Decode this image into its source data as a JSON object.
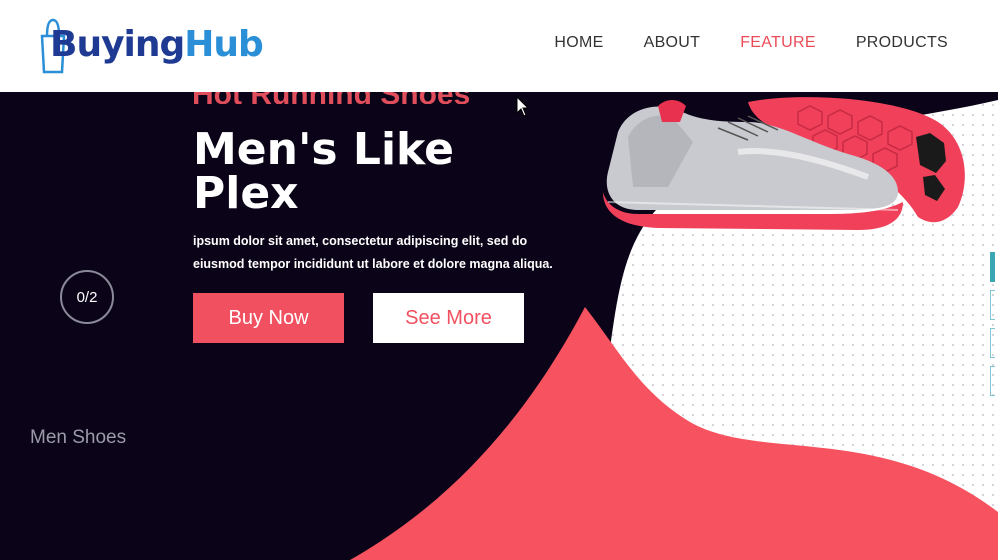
{
  "header": {
    "logo": {
      "brand": "Buying",
      "brand_accent": "Hub"
    },
    "nav": [
      {
        "label": "HOME"
      },
      {
        "label": "ABOUT"
      },
      {
        "label": "FEATURE",
        "active": true
      },
      {
        "label": "PRODUCTS"
      }
    ]
  },
  "hero": {
    "slide_counter": "0/2",
    "category": "Men Shoes",
    "kicker": "Hot Running Shoes",
    "title": "Men's Like Plex",
    "description": "ipsum dolor sit amet, consectetur adipiscing elit, sed do eiusmod tempor incididunt ut labore et dolore magna aliqua.",
    "buy_button": "Buy Now",
    "more_button": "See More"
  },
  "colors": {
    "accent": "#f0505f",
    "dark_bg": "#0b0418",
    "logo_blue": "#1f3a93",
    "logo_light_blue": "#2a8fd6"
  }
}
